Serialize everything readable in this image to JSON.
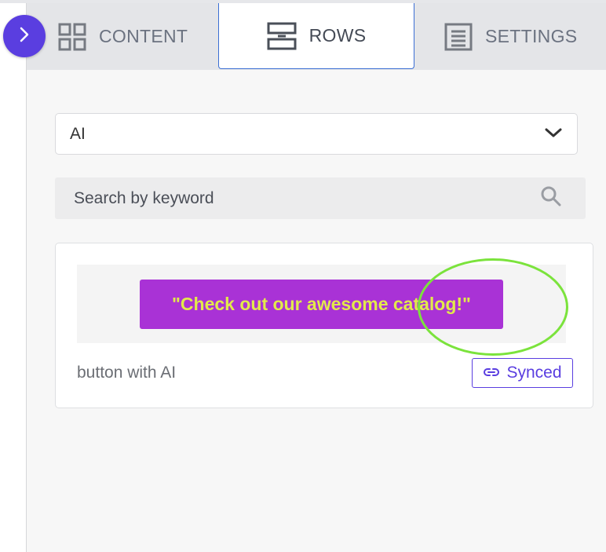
{
  "tabs": [
    {
      "label": "CONTENT",
      "icon": "grid-icon",
      "active": false
    },
    {
      "label": "ROWS",
      "icon": "rows-icon",
      "active": true
    },
    {
      "label": "SETTINGS",
      "icon": "settings-list-icon",
      "active": false
    }
  ],
  "sidebar_toggle": {
    "icon": "chevron-right-icon"
  },
  "row_category_select": {
    "value": "AI",
    "icon": "chevron-down-icon"
  },
  "search": {
    "placeholder": "Search by keyword",
    "value": "",
    "icon": "search-icon"
  },
  "saved_row": {
    "preview_button_text": "\"Check out our awesome catalog!\"",
    "name": "button with AI",
    "synced_label": "Synced",
    "synced_icon": "link-icon"
  },
  "colors": {
    "accent": "#5a3ee0",
    "active_tab_border": "#3b6fd4",
    "preview_button_bg": "#a932d6",
    "preview_button_text": "#e2ea4a",
    "annotation_ring": "#7be33c"
  }
}
